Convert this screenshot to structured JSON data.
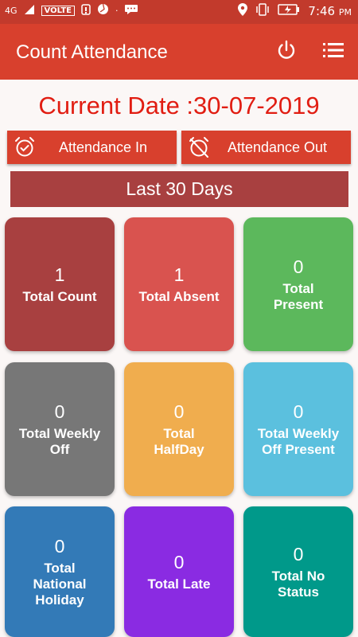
{
  "status_bar": {
    "network": "4G",
    "volte": "VOLTE",
    "time": "7:46",
    "ampm": "PM"
  },
  "app_bar": {
    "title": "Count Attendance",
    "icons": [
      "power-icon",
      "menu-list-icon"
    ]
  },
  "current_date": "Current Date :30-07-2019",
  "buttons": {
    "attendance_in": "Attendance In",
    "attendance_out": "Attendance Out"
  },
  "period_label": "Last 30 Days",
  "cards": [
    {
      "value": "1",
      "label": "Total Count",
      "color": "#a84040"
    },
    {
      "value": "1",
      "label": "Total Absent",
      "color": "#d9534f"
    },
    {
      "value": "0",
      "label": "Total Present",
      "color": "#5cb85c"
    },
    {
      "value": "0",
      "label": "Total Weekly Off",
      "color": "#777777"
    },
    {
      "value": "0",
      "label": "Total HalfDay",
      "color": "#f0ad4e"
    },
    {
      "value": "0",
      "label": "Total Weekly Off Present",
      "color": "#5bc0de"
    },
    {
      "value": "0",
      "label": "Total National Holiday",
      "color": "#337ab7"
    },
    {
      "value": "0",
      "label": "Total Late",
      "color": "#8a2be2"
    },
    {
      "value": "0",
      "label": "Total No Status",
      "color": "#00998a"
    }
  ]
}
